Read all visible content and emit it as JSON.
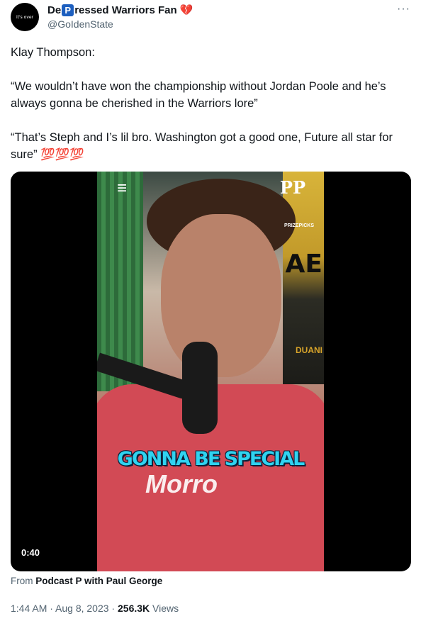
{
  "author": {
    "avatar_text": "it's over",
    "name_prefix": "De",
    "name_badge": "P",
    "name_suffix": "ressed Warriors Fan",
    "heart": "💔",
    "handle": "@GoIdenState"
  },
  "more_icon": "···",
  "tweet": {
    "text": "Klay Thompson:\n\n“We wouldn’t have won the championship without Jordan Poole and he’s always gonna be cherished in the Warriors lore”\n\n“That’s Steph and I’s lil bro. Washington got a good one, Future all star for sure” 💯💯💯"
  },
  "video": {
    "logo_left": "≡",
    "logo_right": "PP",
    "partner": "PRIZEPICKS",
    "poster_text": "AE",
    "poster_subtext": "DUANI",
    "shirt_text": "Morro",
    "caption": "GONNA BE SPECIAL",
    "duration": "0:40"
  },
  "source": {
    "prefix": "From",
    "name": "Podcast P with Paul George"
  },
  "meta": {
    "time": "1:44 AM · Aug 8, 2023 · ",
    "views": "256.3K",
    "views_label": " Views"
  }
}
